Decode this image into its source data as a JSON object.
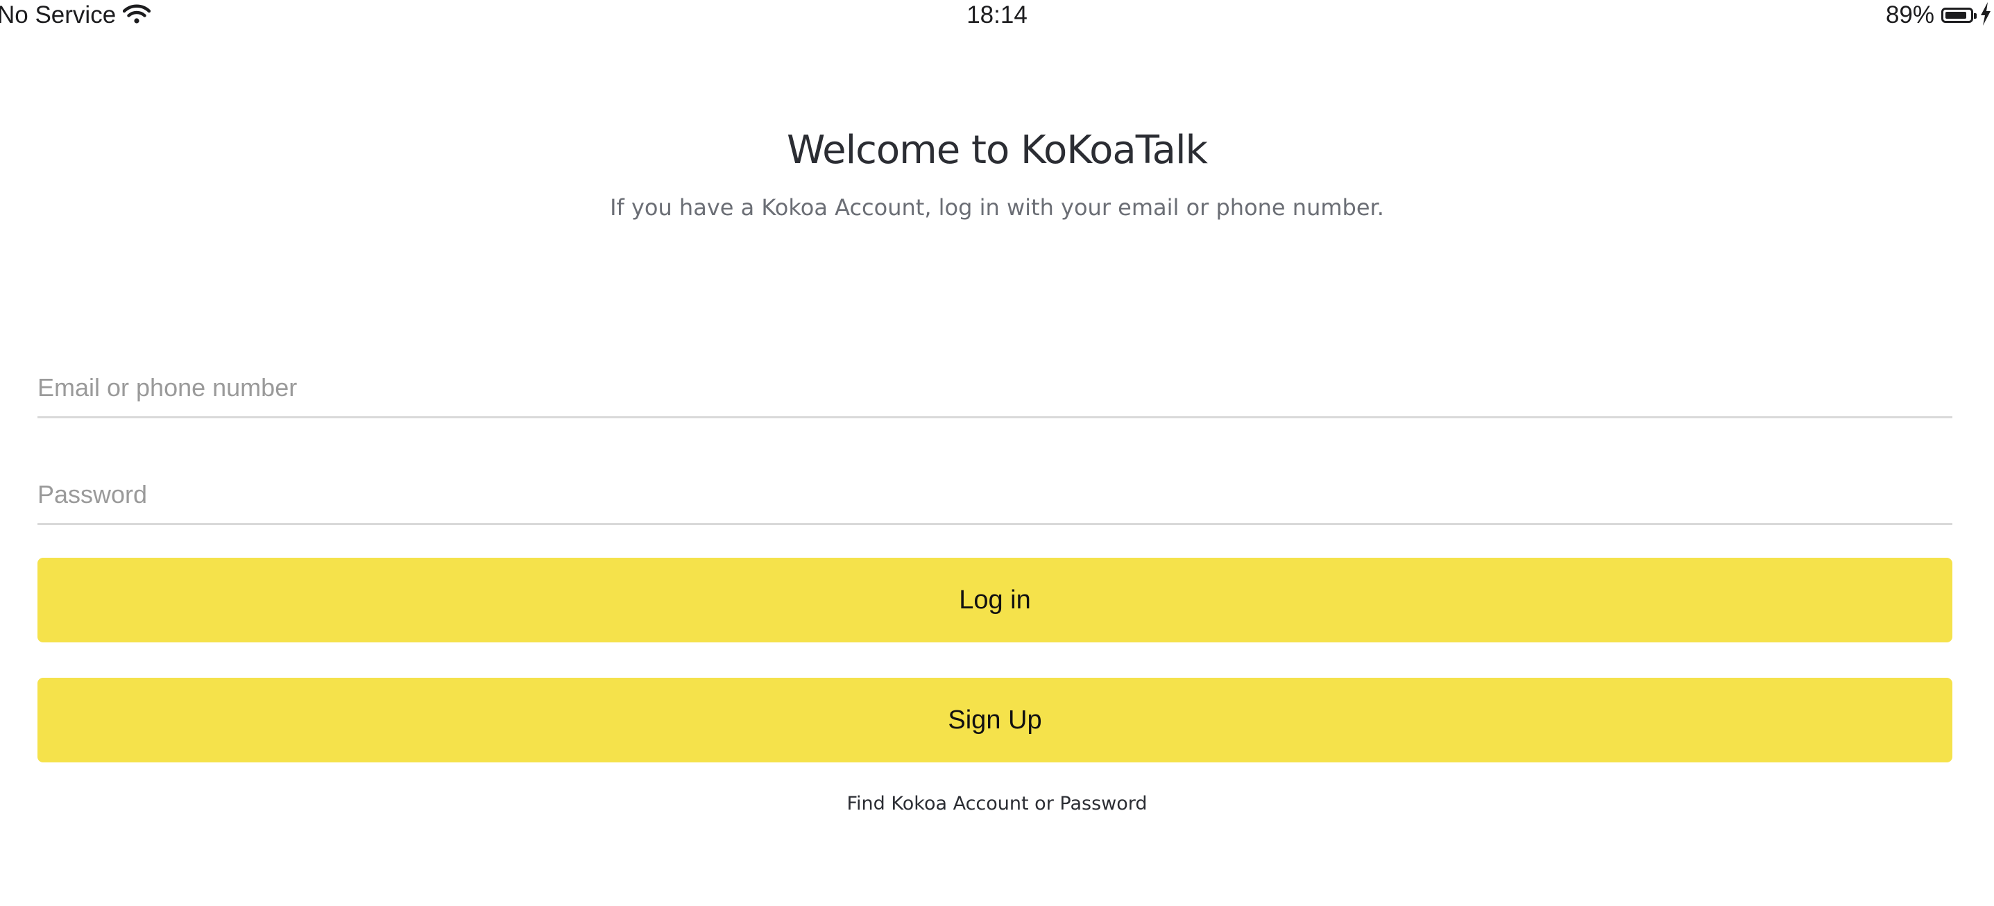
{
  "status_bar": {
    "carrier": "No Service",
    "time": "18:14",
    "battery_percent": "89%",
    "battery_level": 0.89,
    "icons": [
      "wifi-icon",
      "battery-icon",
      "charging-bolt-icon"
    ]
  },
  "header": {
    "title": "Welcome to KoKoaTalk",
    "subtitle": "If you have a Kokoa Account, log in with your email or phone number."
  },
  "form": {
    "email_placeholder": "Email or phone number",
    "email_value": "",
    "password_placeholder": "Password",
    "password_value": "",
    "login_label": "Log in",
    "signup_label": "Sign Up",
    "find_account_label": "Find Kokoa Account or Password"
  },
  "colors": {
    "button_yellow": "#f5e24b",
    "background": "#ffffff",
    "text_dark": "#2b2d33",
    "text_muted": "#6b6e75",
    "placeholder": "#9a9a9a",
    "divider": "#d9d9d9"
  }
}
